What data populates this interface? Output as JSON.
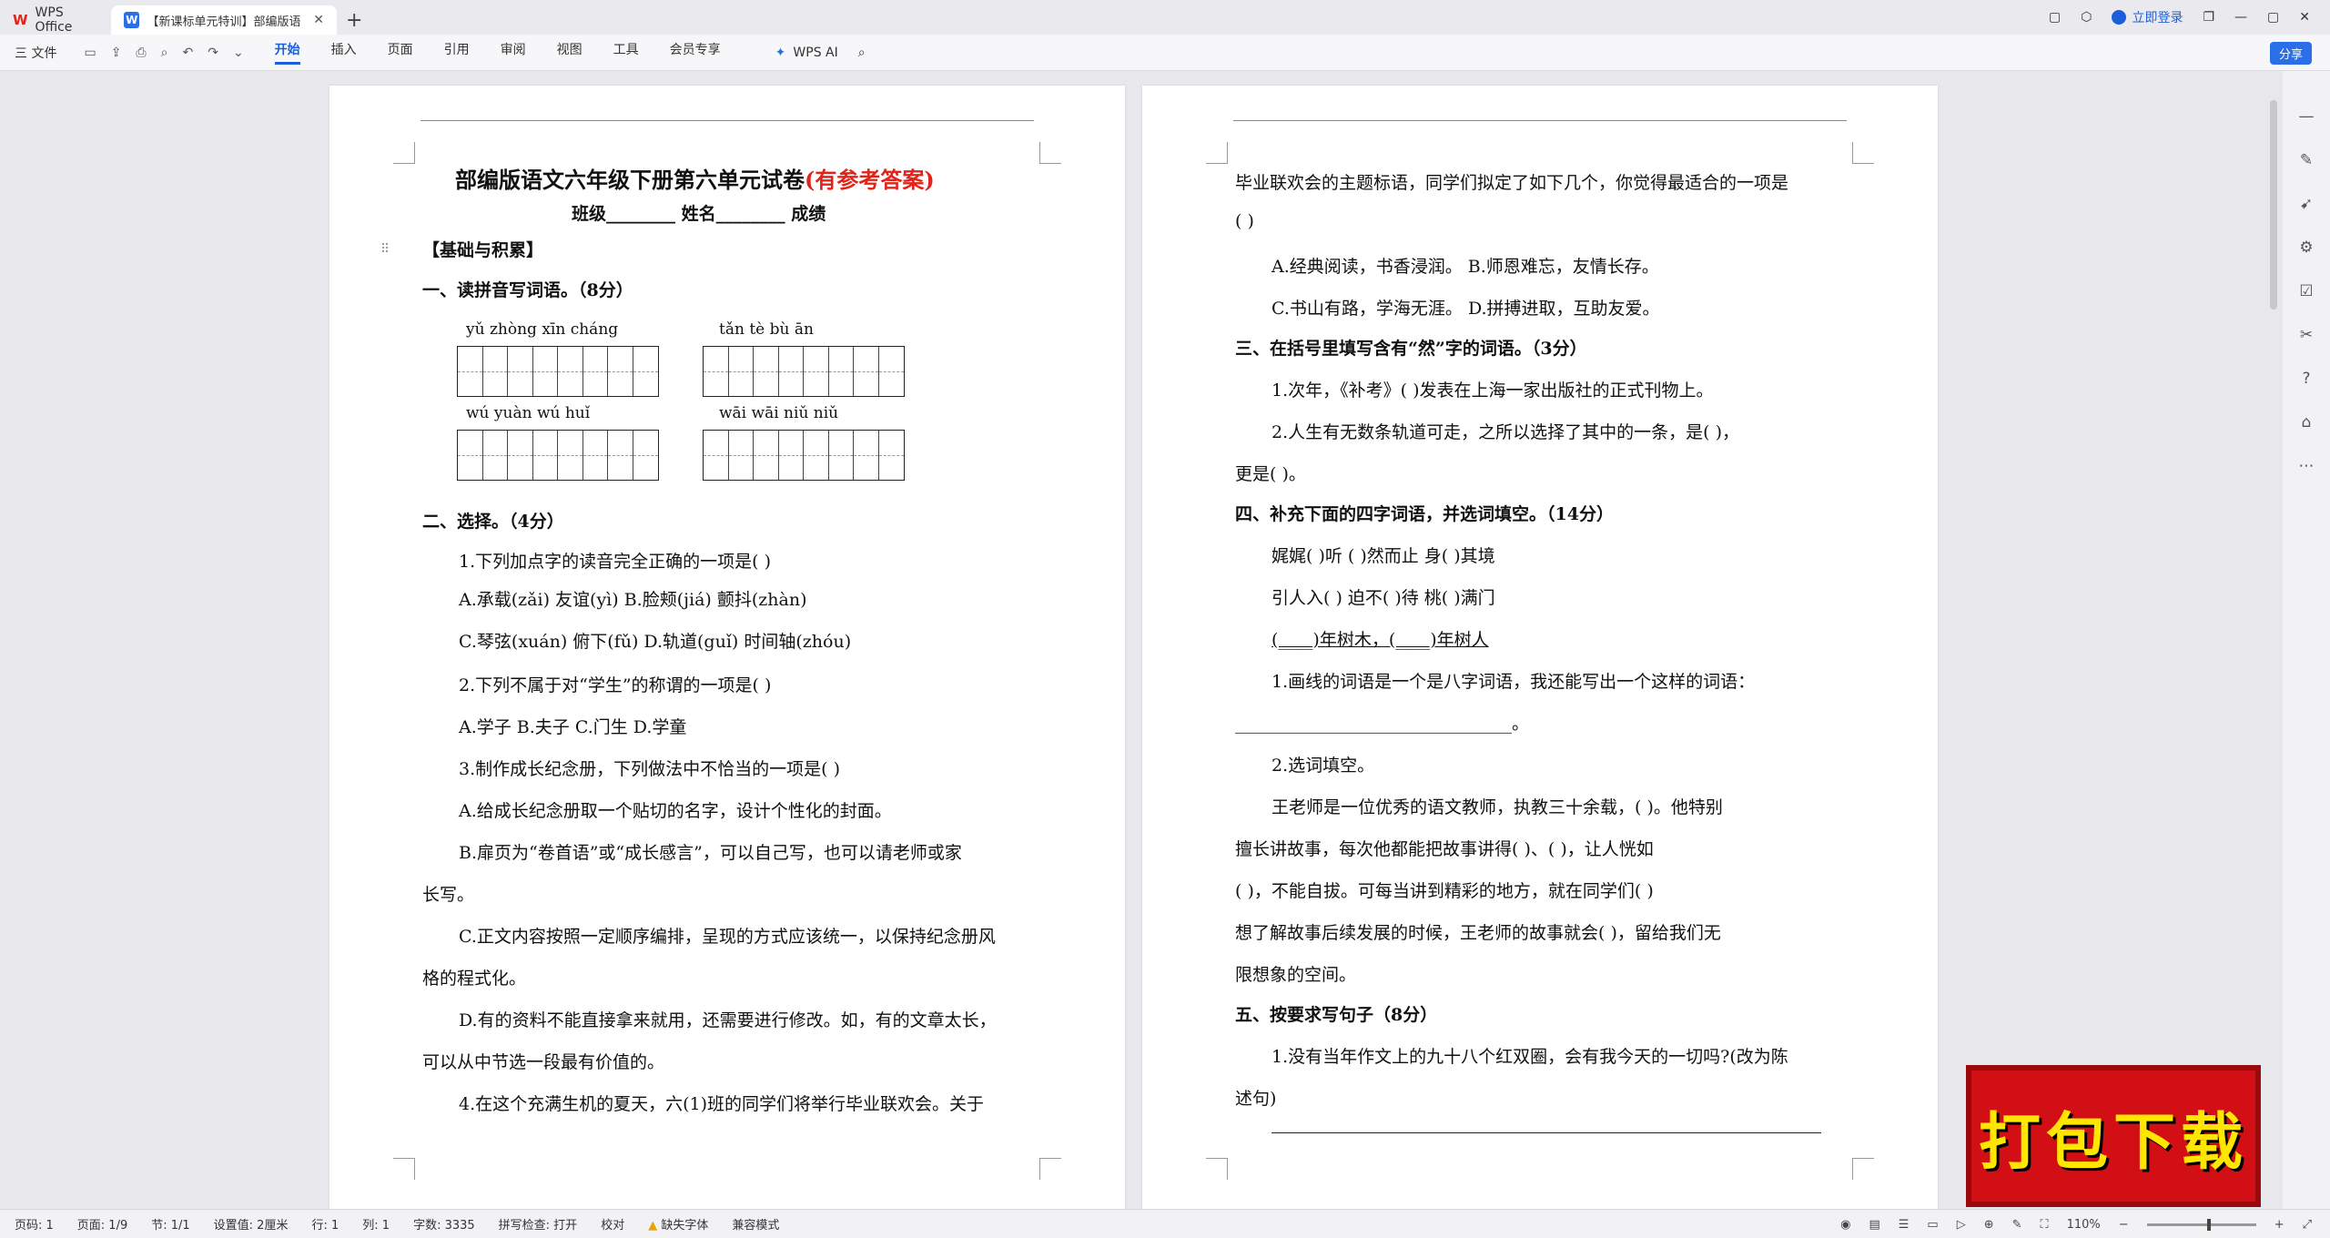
{
  "titlebar": {
    "app_tab": "WPS Office",
    "doc_tab": "【新课标单元特训】部编版语",
    "login": "立即登录"
  },
  "ribbon": {
    "file": "三 文件",
    "menus": [
      "开始",
      "插入",
      "页面",
      "引用",
      "审阅",
      "视图",
      "工具",
      "会员专享"
    ],
    "ai": "WPS AI",
    "share": "分享"
  },
  "page1": {
    "title_main": "部编版语文六年级下册第六单元试卷",
    "title_red": "(有参考答案)",
    "info": "班级________  姓名________  成绩",
    "section_basic": "【基础与积累】",
    "q1_head": "一、读拼音写词语。（8分）",
    "pinyin": [
      {
        "text": "yǔ  zhòng  xīn  cháng"
      },
      {
        "text": "tǎn   tè    bù    ān"
      },
      {
        "text": "wú  yuàn  wú  huǐ"
      },
      {
        "text": "wāi   wāi   niǔ   niǔ"
      }
    ],
    "q2_head": "二、选择。（4分）",
    "q2_1": "1.下列加点字的读音完全正确的一项是(     )",
    "q2_1a": "A.承载(zǎi)          友谊(yì)      B.脸颊(jiá)          颤抖(zhàn)",
    "q2_1c": "C.琴弦(xuán)         俯下(fǔ)      D.轨道(guǐ)          时间轴(zhóu)",
    "q2_2": "2.下列不属于对“学生”的称谓的一项是(     )",
    "q2_2opts": "A.学子      B.夫子      C.门生      D.学童",
    "q2_3": "3.制作成长纪念册，下列做法中不恰当的一项是(     )",
    "q2_3a": "A.给成长纪念册取一个贴切的名字，设计个性化的封面。",
    "q2_3b1": "B.扉页为“卷首语”或“成长感言”，可以自己写，也可以请老师或家",
    "q2_3b2": "长写。",
    "q2_3c1": "C.正文内容按照一定顺序编排，呈现的方式应该统一，以保持纪念册风",
    "q2_3c2": "格的程式化。",
    "q2_3d1": "D.有的资料不能直接拿来就用，还需要进行修改。如，有的文章太长，",
    "q2_3d2": "可以从中节选一段最有价值的。",
    "q2_4": "4.在这个充满生机的夏天，六(1)班的同学们将举行毕业联欢会。关于"
  },
  "page2": {
    "l1": "毕业联欢会的主题标语，同学们拟定了如下几个，你觉得最适合的一项是",
    "l2": "(     )",
    "optAB": "A.经典阅读，书香浸润。      B.师恩难忘，友情长存。",
    "optCD": "C.书山有路，学海无涯。      D.拼搏进取，互助友爱。",
    "q3_head": "三、在括号里填写含有“然”字的词语。（3分）",
    "q3_1": "1.次年，《补考》(           )发表在上海一家出版社的正式刊物上。",
    "q3_2": "2.人生有无数条轨道可走，之所以选择了其中的一条，是(           )，",
    "q3_2b": "更是(           )。",
    "q4_head": "四、补充下面的四字词语，并选词填空。（14分）",
    "q4_r1": "娓娓(      )听      (      )然而止      身(      )其境",
    "q4_r2": "引人入(      )      迫不(      )待      桃(      )满门",
    "q4_r3": "(____)年树木，(____)年树人",
    "q4_1": "1.画线的词语是一个是八字词语，我还能写出一个这样的词语：",
    "q4_1b": "________________________________。",
    "q4_2": "2.选词填空。",
    "p_1": "王老师是一位优秀的语文教师，执教三十余载，(               )。他特别",
    "p_2": "擅长讲故事，每次他都能把故事讲得(             )、(             )，让人恍如",
    "p_3": "(             )，不能自拔。可每当讲到精彩的地方，就在同学们(             )",
    "p_4": "想了解故事后续发展的时候，王老师的故事就会(               )，留给我们无",
    "p_5": "限想象的空间。",
    "q5_head": "五、按要求写句子（8分）",
    "q5_1": "1.没有当年作文上的九十八个红双圈，会有我今天的一切吗?(改为陈",
    "q5_1b": "述句)"
  },
  "status": {
    "items": [
      "页码: 1",
      "页面: 1/9",
      "节: 1/1",
      "设置值: 2厘米",
      "行: 1",
      "列: 1",
      "字数: 3335",
      "拼写检查: 打开",
      "校对",
      "缺失字体",
      "兼容模式"
    ],
    "zoom": "110%"
  },
  "banner": "打包下载"
}
